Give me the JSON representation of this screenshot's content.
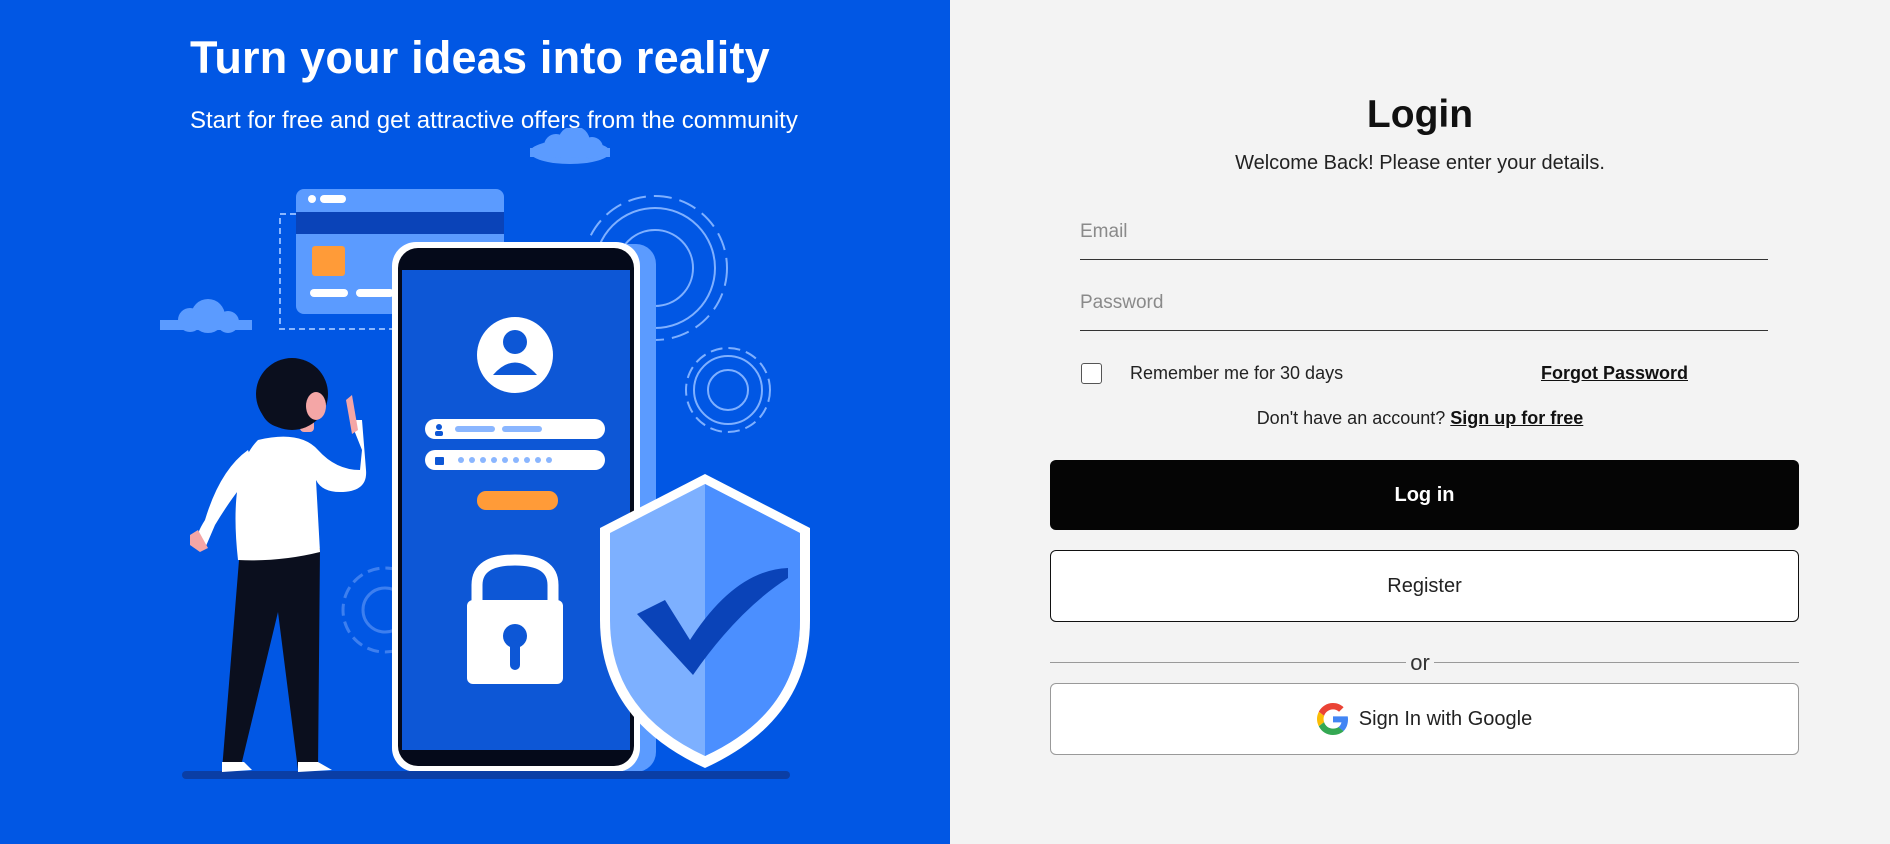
{
  "hero": {
    "title": "Turn your ideas into reality",
    "subtitle": "Start for free and get attractive offers from the community"
  },
  "login": {
    "title": "Login",
    "subtitle": "Welcome Back! Please enter your details.",
    "email_placeholder": "Email",
    "email_value": "",
    "password_placeholder": "Password",
    "password_value": "",
    "remember_label": "Remember me for 30 days",
    "remember_checked": false,
    "forgot_label": "Forgot Password",
    "signup_prompt": "Don't have an account?",
    "signup_link": "Sign up for free",
    "login_button": "Log in",
    "register_button": "Register",
    "or_text": "or",
    "google_button": "Sign In with Google"
  },
  "colors": {
    "brand_blue": "#0157e4",
    "panel_bg": "#f3f3f3",
    "primary_button": "#050505"
  },
  "icons": {
    "google": "google-g-icon",
    "illustration": "security-login-illustration"
  }
}
